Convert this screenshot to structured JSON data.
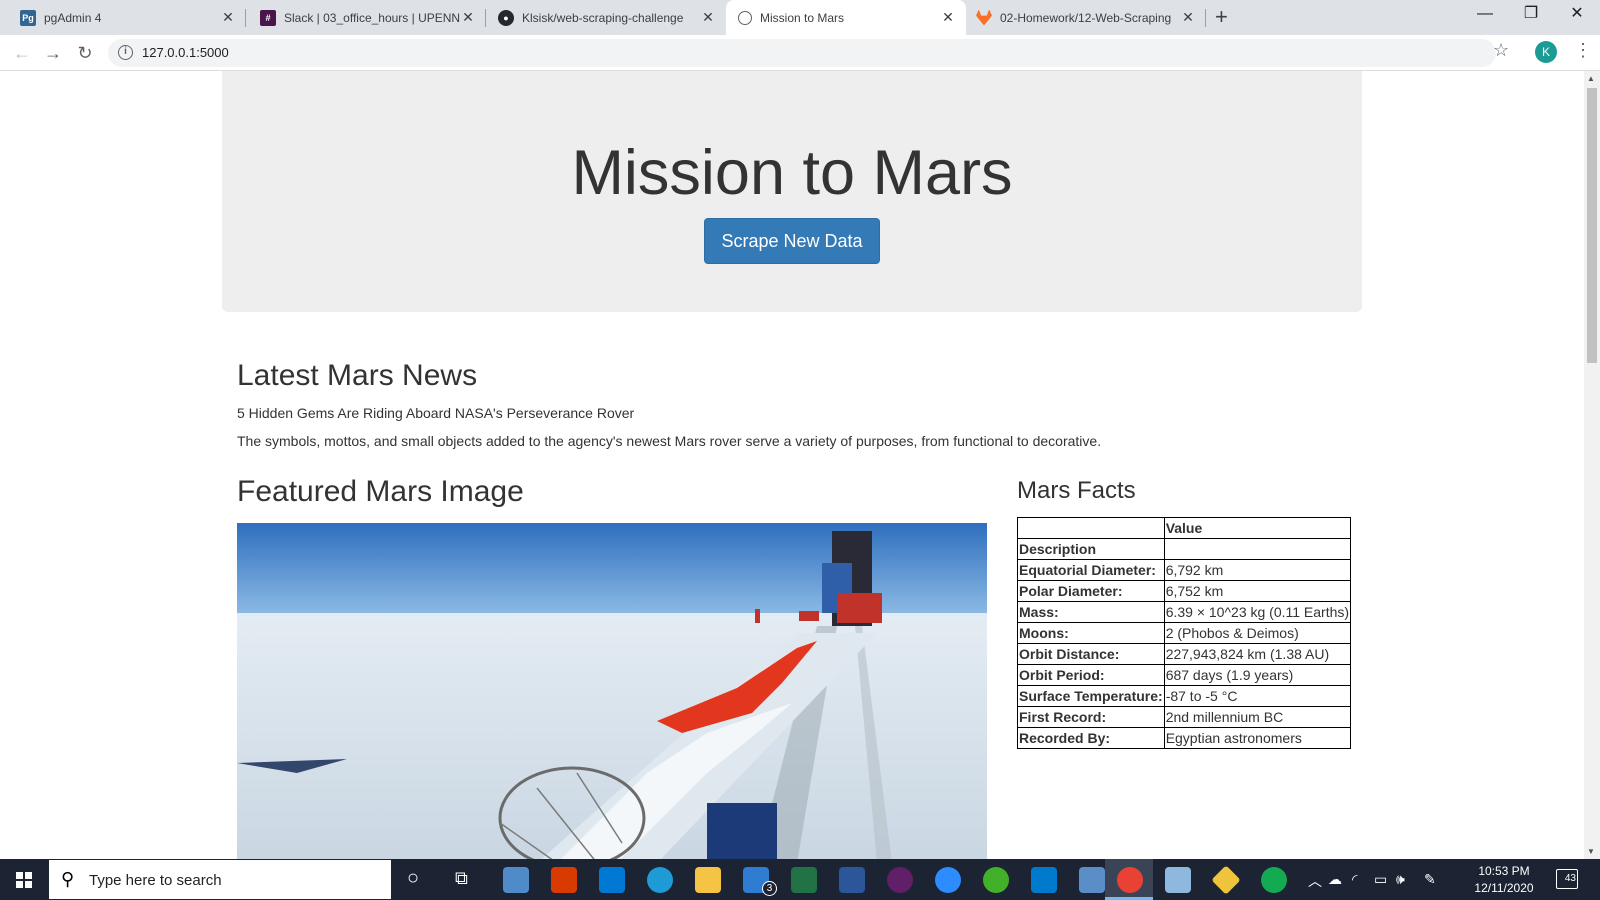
{
  "browser": {
    "tabs": [
      {
        "title": "pgAdmin 4",
        "icon": "pgadmin-icon",
        "active": false
      },
      {
        "title": "Slack | 03_office_hours | UPENN-",
        "icon": "slack-icon",
        "active": false
      },
      {
        "title": "Klsisk/web-scraping-challenge",
        "icon": "github-icon",
        "active": false
      },
      {
        "title": "Mission to Mars",
        "icon": "globe-icon",
        "active": true
      },
      {
        "title": "02-Homework/12-Web-Scraping",
        "icon": "gitlab-icon",
        "active": false
      }
    ],
    "url": "127.0.0.1:5000",
    "profile_initial": "K"
  },
  "page": {
    "title": "Mission to Mars",
    "scrape_button": "Scrape New Data",
    "news": {
      "heading": "Latest Mars News",
      "title": "5 Hidden Gems Are Riding Aboard NASA's Perseverance Rover",
      "paragraph": "The symbols, mottos, and small objects added to the agency's newest Mars rover serve a variety of purposes, from functional to decorative."
    },
    "featured": {
      "heading": "Featured Mars Image"
    },
    "facts": {
      "heading": "Mars Facts",
      "column_header": "Value",
      "index_header": "Description",
      "rows": [
        {
          "label": "Equatorial Diameter:",
          "value": "6,792 km"
        },
        {
          "label": "Polar Diameter:",
          "value": "6,752 km"
        },
        {
          "label": "Mass:",
          "value": "6.39 × 10^23 kg (0.11 Earths)"
        },
        {
          "label": "Moons:",
          "value": "2 (Phobos & Deimos)"
        },
        {
          "label": "Orbit Distance:",
          "value": "227,943,824 km (1.38 AU)"
        },
        {
          "label": "Orbit Period:",
          "value": "687 days (1.9 years)"
        },
        {
          "label": "Surface Temperature:",
          "value": "-87 to -5 °C"
        },
        {
          "label": "First Record:",
          "value": "2nd millennium BC"
        },
        {
          "label": "Recorded By:",
          "value": "Egyptian astronomers"
        }
      ]
    }
  },
  "taskbar": {
    "search_placeholder": "Type here to search",
    "mail_badge": "3",
    "time": "10:53 PM",
    "date": "12/11/2020",
    "notification_count": "43"
  },
  "colors": {
    "primary_button": "#337ab7",
    "jumbotron_bg": "#eeeeee",
    "taskbar_bg": "#1c2433"
  }
}
